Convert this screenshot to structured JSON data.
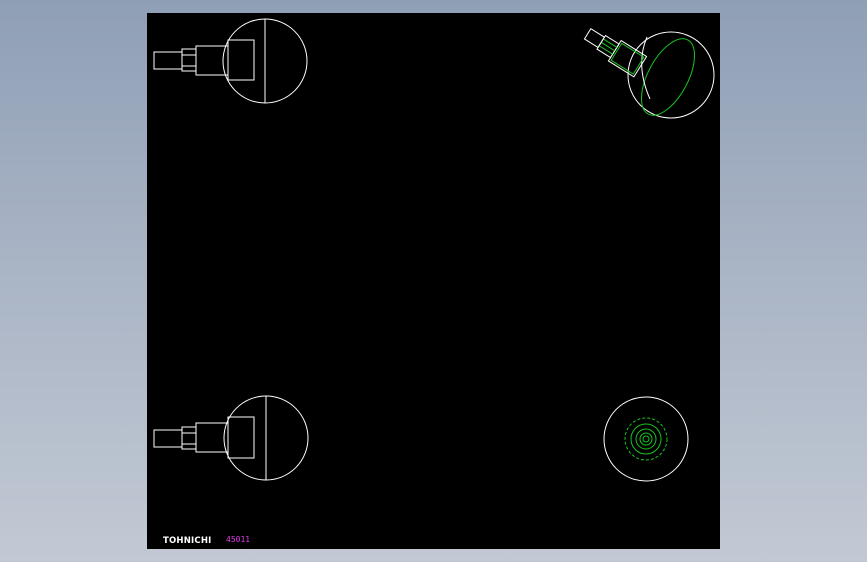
{
  "drawing": {
    "brand_label": "TOHNICHI",
    "model_label": "45011"
  },
  "colors": {
    "background": "#8f9fb6",
    "viewport": "#000000",
    "outline": "#ffffff",
    "hidden_line": "#19c41f",
    "model_text": "#e03ae6"
  }
}
